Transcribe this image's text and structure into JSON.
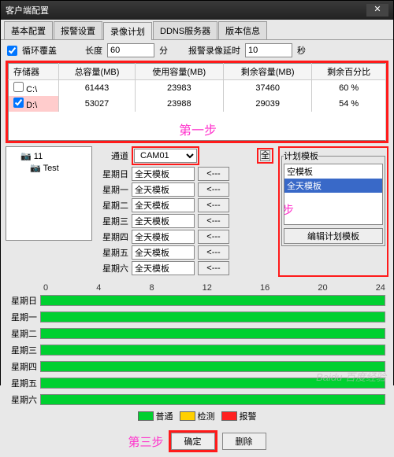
{
  "window": {
    "title": "客户端配置"
  },
  "tabs": [
    "基本配置",
    "报警设置",
    "录像计划",
    "DDNS服务器",
    "版本信息"
  ],
  "active_tab": 2,
  "row1": {
    "loop_cover": "循环覆盖",
    "length_lbl": "长度",
    "length_val": "60",
    "unit_min": "分",
    "alarm_delay_lbl": "报警录像延时",
    "alarm_delay_val": "10",
    "unit_sec": "秒"
  },
  "storage": {
    "headers": [
      "存储器",
      "总容量(MB)",
      "使用容量(MB)",
      "剩余容量(MB)",
      "剩余百分比"
    ],
    "rows": [
      {
        "chk": false,
        "name": "C:\\",
        "total": "61443",
        "used": "23983",
        "free": "37460",
        "pct": "60 %"
      },
      {
        "chk": true,
        "name": "D:\\",
        "total": "53027",
        "used": "23988",
        "free": "29039",
        "pct": "54 %"
      }
    ]
  },
  "steps": {
    "one": "第一步",
    "two": "第二步",
    "three": "第三步"
  },
  "tree": {
    "root": "11",
    "child": "Test"
  },
  "channel": {
    "lbl": "通道",
    "value": "CAM01",
    "all": "全",
    "day_labels": [
      "星期日",
      "星期一",
      "星期二",
      "星期三",
      "星期四",
      "星期五",
      "星期六"
    ],
    "template": "全天模板",
    "arrow": "<---"
  },
  "plan": {
    "legend": "计划模板",
    "items": [
      "空模板",
      "全天模板"
    ],
    "edit_btn": "编辑计划模板"
  },
  "timeline": {
    "ticks": [
      "0",
      "4",
      "8",
      "12",
      "16",
      "20",
      "24"
    ],
    "days": [
      "星期日",
      "星期一",
      "星期二",
      "星期三",
      "星期四",
      "星期五",
      "星期六"
    ]
  },
  "legend": {
    "normal": "普通",
    "detect": "检测",
    "alarm": "报警"
  },
  "footer": {
    "ok": "确定",
    "del": "删除"
  },
  "watermark": "Baidu 百度经验"
}
